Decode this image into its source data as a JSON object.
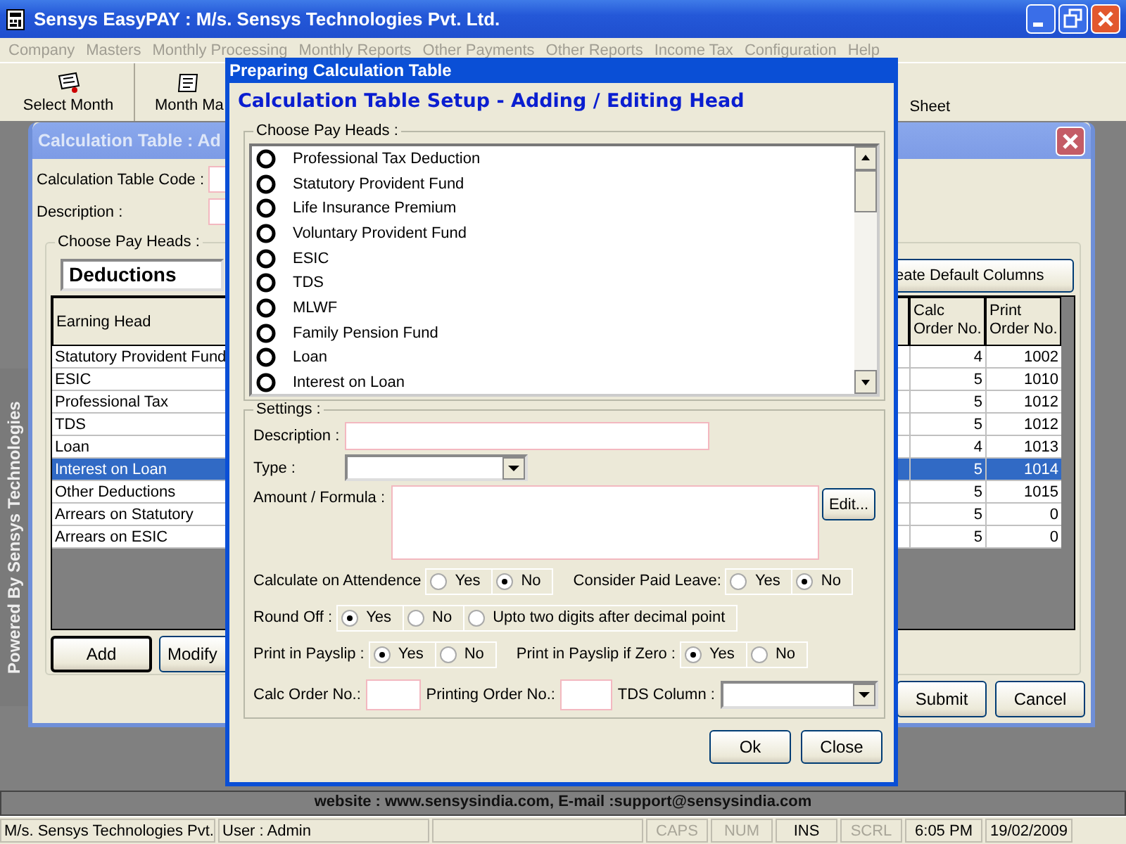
{
  "app_window": {
    "title": "Sensys EasyPAY : M/s. Sensys Technologies Pvt. Ltd."
  },
  "menu": [
    "Company",
    "Masters",
    "Monthly Processing",
    "Monthly Reports",
    "Other Payments",
    "Other Reports",
    "Income Tax",
    "Configuration",
    "Help"
  ],
  "toolbar": [
    {
      "label": "Select Month",
      "kind": "calendar"
    },
    {
      "label": "Month Ma",
      "kind": "note"
    },
    {
      "label": "Sheet",
      "kind": "none"
    }
  ],
  "side_banner": "Powered By Sensys Technologies",
  "background_dialog": {
    "title": "Calculation Table : Ad",
    "code_label": "Calculation Table Code :",
    "description_label": "Description :",
    "group_label": "Choose Pay Heads :",
    "pay_head_type": "Deductions",
    "default_columns_button": "eate Default Columns",
    "columns": [
      "Earning Head",
      "Calc Order No.",
      "Print Order No."
    ],
    "rows": [
      {
        "head": "Statutory Provident Fund",
        "calc": "4",
        "print": "1002",
        "selected": false
      },
      {
        "head": "ESIC",
        "calc": "5",
        "print": "1010",
        "selected": false
      },
      {
        "head": "Professional Tax",
        "calc": "5",
        "print": "1012",
        "selected": false
      },
      {
        "head": "TDS",
        "calc": "5",
        "print": "1012",
        "selected": false
      },
      {
        "head": "Loan",
        "calc": "4",
        "print": "1013",
        "selected": false
      },
      {
        "head": "Interest on Loan",
        "calc": "5",
        "print": "1014",
        "selected": true
      },
      {
        "head": "Other Deductions",
        "calc": "5",
        "print": "1015",
        "selected": false
      },
      {
        "head": "Arrears on Statutory",
        "calc": "5",
        "print": "0",
        "selected": false
      },
      {
        "head": "Arrears on ESIC",
        "calc": "5",
        "print": "0",
        "selected": false
      }
    ],
    "left_buttons": [
      "Add",
      "Modify"
    ],
    "right_buttons": [
      "Submit",
      "Cancel"
    ]
  },
  "dialog": {
    "title": "Preparing Calculation Table",
    "heading": "Calculation Table Setup - Adding / Editing Head",
    "pay_heads_label": "Choose Pay Heads :",
    "pay_heads": [
      {
        "label": "Professional Tax Deduction",
        "selected": false
      },
      {
        "label": "Statutory Provident Fund",
        "selected": false
      },
      {
        "label": "Life Insurance Premium",
        "selected": false
      },
      {
        "label": "Voluntary Provident Fund",
        "selected": false
      },
      {
        "label": "ESIC",
        "selected": false
      },
      {
        "label": "TDS",
        "selected": false
      },
      {
        "label": "MLWF",
        "selected": false
      },
      {
        "label": "Family Pension Fund",
        "selected": false
      },
      {
        "label": "Loan",
        "selected": false
      },
      {
        "label": "Interest on Loan",
        "selected": false
      }
    ],
    "settings_label": "Settings :",
    "description_label": "Description :",
    "type_label": "Type :",
    "formula_label": "Amount / Formula :",
    "edit_button": "Edit...",
    "option_rows": [
      [
        {
          "label": "Calculate on Attendence",
          "options": [
            {
              "label": "Yes",
              "selected": false
            },
            {
              "label": "No",
              "selected": true
            }
          ]
        },
        {
          "label": "Consider Paid Leave:",
          "options": [
            {
              "label": "Yes",
              "selected": false
            },
            {
              "label": "No",
              "selected": true
            }
          ]
        }
      ],
      [
        {
          "label": "Round Off :",
          "options": [
            {
              "label": "Yes",
              "selected": true
            },
            {
              "label": "No",
              "selected": false
            },
            {
              "label": "Upto two digits after decimal point",
              "selected": false
            }
          ]
        }
      ],
      [
        {
          "label": "Print in Payslip :",
          "options": [
            {
              "label": "Yes",
              "selected": true
            },
            {
              "label": "No",
              "selected": false
            }
          ]
        },
        {
          "label": "Print in Payslip if Zero :",
          "options": [
            {
              "label": "Yes",
              "selected": true
            },
            {
              "label": "No",
              "selected": false
            }
          ]
        }
      ]
    ],
    "calc_order_label": "Calc Order No.:",
    "print_order_label": "Printing Order No.:",
    "tds_label": "TDS Column :",
    "buttons": [
      "Ok",
      "Close"
    ]
  },
  "footer": "website : www.sensysindia.com, E-mail :support@sensysindia.com",
  "status_bar": [
    {
      "text": "M/s. Sensys Technologies Pvt.",
      "enabled": true
    },
    {
      "text": "User : Admin",
      "enabled": true
    },
    {
      "text": "CAPS",
      "enabled": false
    },
    {
      "text": "NUM",
      "enabled": false
    },
    {
      "text": "INS",
      "enabled": true
    },
    {
      "text": "SCRL",
      "enabled": false
    },
    {
      "text": "6:05 PM",
      "enabled": true
    },
    {
      "text": "19/02/2009",
      "enabled": true
    }
  ]
}
